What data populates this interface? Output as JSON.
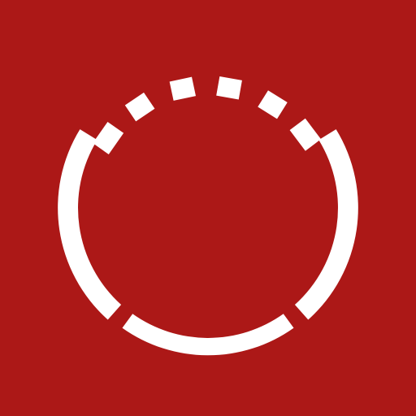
{
  "icon": {
    "name": "segmented-ring-logo",
    "background_color": "#AC1817",
    "foreground_color": "#FFFFFF"
  }
}
